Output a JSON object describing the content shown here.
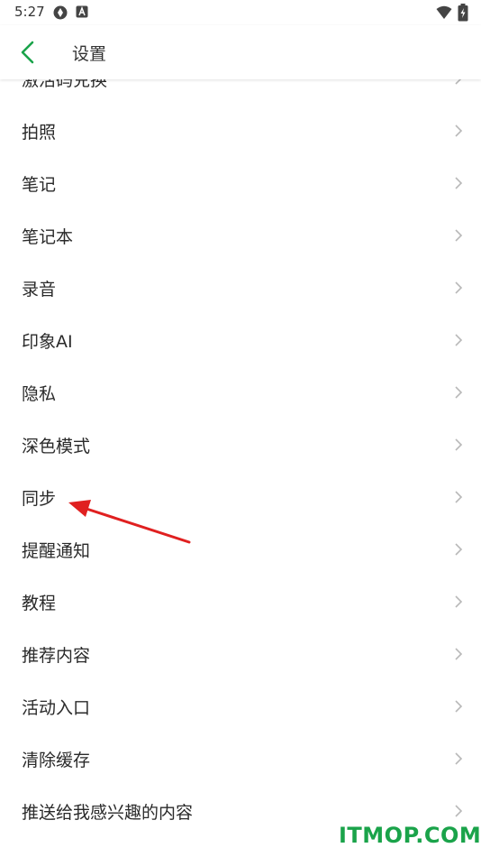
{
  "status_bar": {
    "time": "5:27",
    "icons": [
      "camera-shutter-icon",
      "a-letter-icon",
      "wifi-icon",
      "battery-icon"
    ]
  },
  "app_bar": {
    "back_icon": "chevron-left-icon",
    "title": "设置",
    "accent_color": "#1aa34a"
  },
  "settings": {
    "items": [
      {
        "label": "激活码兑换"
      },
      {
        "label": "拍照"
      },
      {
        "label": "笔记"
      },
      {
        "label": "笔记本"
      },
      {
        "label": "录音"
      },
      {
        "label": "印象AI"
      },
      {
        "label": "隐私"
      },
      {
        "label": "深色模式"
      },
      {
        "label": "同步"
      },
      {
        "label": "提醒通知"
      },
      {
        "label": "教程"
      },
      {
        "label": "推荐内容"
      },
      {
        "label": "活动入口"
      },
      {
        "label": "清除缓存"
      },
      {
        "label": "推送给我感兴趣的内容"
      }
    ],
    "chevron_icon": "chevron-right-icon"
  },
  "annotation": {
    "color": "#e02020",
    "icon": "red-arrow-annotation"
  },
  "watermark": {
    "part1": "ITMOP",
    "part2": ".COM",
    "color1": "#1aa34a",
    "color2": "#1aa34a"
  }
}
